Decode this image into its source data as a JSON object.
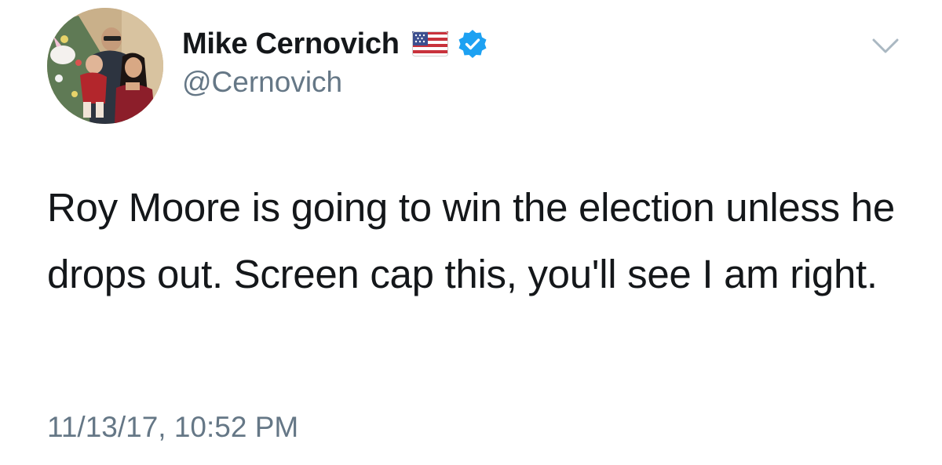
{
  "tweet": {
    "author": {
      "display_name": "Mike Cernovich",
      "handle": "@Cernovich",
      "verified": true,
      "flag_icon": "us-flag-icon",
      "avatar_icon": "profile-photo-avatar"
    },
    "text": "Roy Moore is going to win the election unless he drops out. Screen cap this, you'll see I am right.",
    "timestamp": "11/13/17, 10:52 PM",
    "menu_icon": "chevron-down-icon"
  },
  "colors": {
    "text_primary": "#14171a",
    "text_secondary": "#657786",
    "verified_blue": "#1da1f2",
    "caret_gray": "#aab8c2"
  }
}
